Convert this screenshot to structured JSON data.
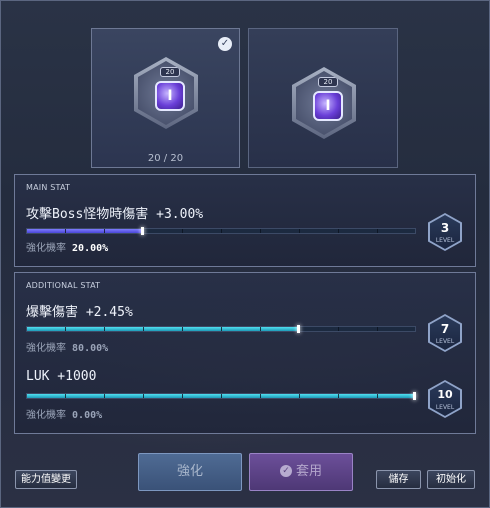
{
  "slots": {
    "left": {
      "badge": "20",
      "gem_glyph": "I",
      "count": "20 / 20"
    },
    "right": {
      "badge": "20",
      "gem_glyph": "I"
    }
  },
  "main_stat": {
    "title": "MAIN STAT",
    "text": "攻擊Boss怪物時傷害 +3.00%",
    "progress": 0.3,
    "rate_label": "強化機率",
    "rate_value": "20.00%",
    "rate_color": "#ffffff",
    "level": "3",
    "level_label": "LEVEL"
  },
  "additional_stat": {
    "title": "ADDITIONAL STAT",
    "items": [
      {
        "text": "爆擊傷害 +2.45%",
        "progress": 0.7,
        "rate_label": "強化機率",
        "rate_value": "80.00%",
        "level": "7",
        "level_label": "LEVEL"
      },
      {
        "text": "LUK +1000",
        "progress": 1.0,
        "rate_label": "強化機率",
        "rate_value": "0.00%",
        "level": "10",
        "level_label": "LEVEL"
      }
    ]
  },
  "buttons": {
    "stat_change": "能力值變更",
    "strengthen": "強化",
    "apply": "套用",
    "save": "儲存",
    "initialize": "初始化"
  },
  "colors": {
    "main_bar": "#5a57e8",
    "additional_bar": "#2bbdd6"
  },
  "icons": {
    "checked": "check-circle-icon",
    "apply": "check-circle-icon",
    "gem": "violet-gem-icon"
  }
}
